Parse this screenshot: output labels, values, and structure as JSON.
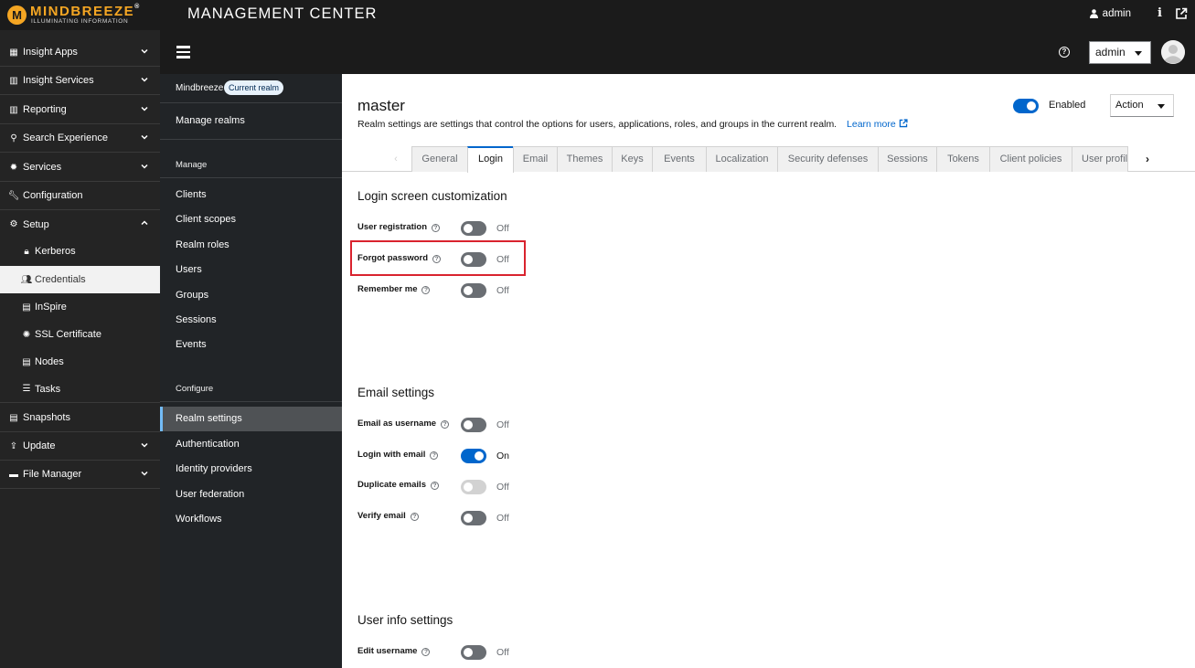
{
  "topbar": {
    "brand": "MINDBREEZE",
    "reg": "®",
    "tagline": "ILLUMINATING INFORMATION",
    "app_title": "MANAGEMENT CENTER",
    "user": "admin",
    "info_label": "i"
  },
  "sidebar": {
    "items": [
      {
        "label": "Insight Apps",
        "icon": "grid-icon"
      },
      {
        "label": "Insight Services",
        "icon": "bar-chart-icon"
      },
      {
        "label": "Reporting",
        "icon": "bar-chart-icon"
      },
      {
        "label": "Search Experience",
        "icon": "search-icon"
      },
      {
        "label": "Services",
        "icon": "gear-icon"
      },
      {
        "label": "Configuration",
        "icon": "wrench-icon"
      },
      {
        "label": "Setup",
        "icon": "cogs-icon"
      },
      {
        "label": "Snapshots",
        "icon": "server-icon"
      },
      {
        "label": "Update",
        "icon": "upload-icon"
      },
      {
        "label": "File Manager",
        "icon": "folder-icon"
      }
    ],
    "setup_children": [
      {
        "label": "Kerberos",
        "icon": "lock-icon"
      },
      {
        "label": "Credentials",
        "icon": "users-icon"
      },
      {
        "label": "InSpire",
        "icon": "server-icon"
      },
      {
        "label": "SSL Certificate",
        "icon": "certificate-icon"
      },
      {
        "label": "Nodes",
        "icon": "server-icon"
      },
      {
        "label": "Tasks",
        "icon": "list-icon"
      }
    ]
  },
  "header": {
    "user_select": "admin"
  },
  "subnav": {
    "realm_name": "Mindbreeze",
    "realm_badge": "Current realm",
    "manage_realms": "Manage realms",
    "manage_section": "Manage",
    "manage_links": [
      "Clients",
      "Client scopes",
      "Realm roles",
      "Users",
      "Groups",
      "Sessions",
      "Events"
    ],
    "configure_section": "Configure",
    "configure_links": [
      "Realm settings",
      "Authentication",
      "Identity providers",
      "User federation",
      "Workflows"
    ]
  },
  "main": {
    "title": "master",
    "description": "Realm settings are settings that control the options for users, applications, roles, and groups in the current realm.",
    "learn_more": "Learn more",
    "enabled_label": "Enabled",
    "enabled": true,
    "action_label": "Action",
    "tabs": [
      "General",
      "Login",
      "Email",
      "Themes",
      "Keys",
      "Events",
      "Localization",
      "Security defenses",
      "Sessions",
      "Tokens",
      "Client policies",
      "User profile"
    ],
    "active_tab": "Login",
    "sections": {
      "login_screen": {
        "title": "Login screen customization",
        "fields": [
          {
            "label": "User registration",
            "state": "Off"
          },
          {
            "label": "Forgot password",
            "state": "Off"
          },
          {
            "label": "Remember me",
            "state": "Off"
          }
        ]
      },
      "email": {
        "title": "Email settings",
        "fields": [
          {
            "label": "Email as username",
            "state": "Off"
          },
          {
            "label": "Login with email",
            "state": "On"
          },
          {
            "label": "Duplicate emails",
            "state": "Off"
          },
          {
            "label": "Verify email",
            "state": "Off"
          }
        ]
      },
      "user_info": {
        "title": "User info settings",
        "fields": [
          {
            "label": "Edit username",
            "state": "Off"
          }
        ]
      }
    }
  },
  "colors": {
    "accent": "#0066cc",
    "highlight": "#d9232e",
    "brand": "#f5a623",
    "sidebar_bg": "#242424",
    "subnav_bg": "#212427"
  }
}
